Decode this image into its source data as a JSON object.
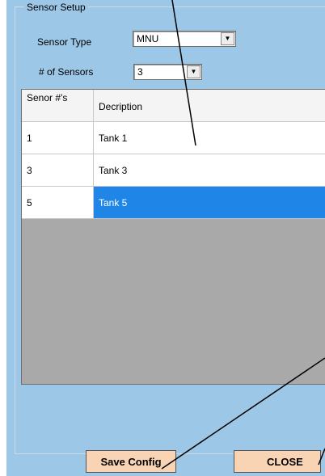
{
  "group_title": "Sensor Setup",
  "sensor_type": {
    "label": "Sensor Type",
    "value": "MNU"
  },
  "num_sensors": {
    "label": "# of Sensors",
    "value": "3"
  },
  "grid": {
    "headers": {
      "number": "Senor #'s",
      "description": "Decription"
    },
    "rows": [
      {
        "number": "1",
        "description": "Tank 1",
        "selected": false
      },
      {
        "number": "3",
        "description": "Tank 3",
        "selected": false
      },
      {
        "number": "5",
        "description": "Tank 5",
        "selected": true
      }
    ]
  },
  "buttons": {
    "save": "Save Config",
    "close": "CLOSE"
  },
  "colors": {
    "panel": "#9cc7e6",
    "selection": "#1f85e6",
    "button": "#f8d4b4",
    "grid_empty": "#a9a9a9"
  },
  "icons": {
    "dropdown": "chevron-down-icon"
  }
}
